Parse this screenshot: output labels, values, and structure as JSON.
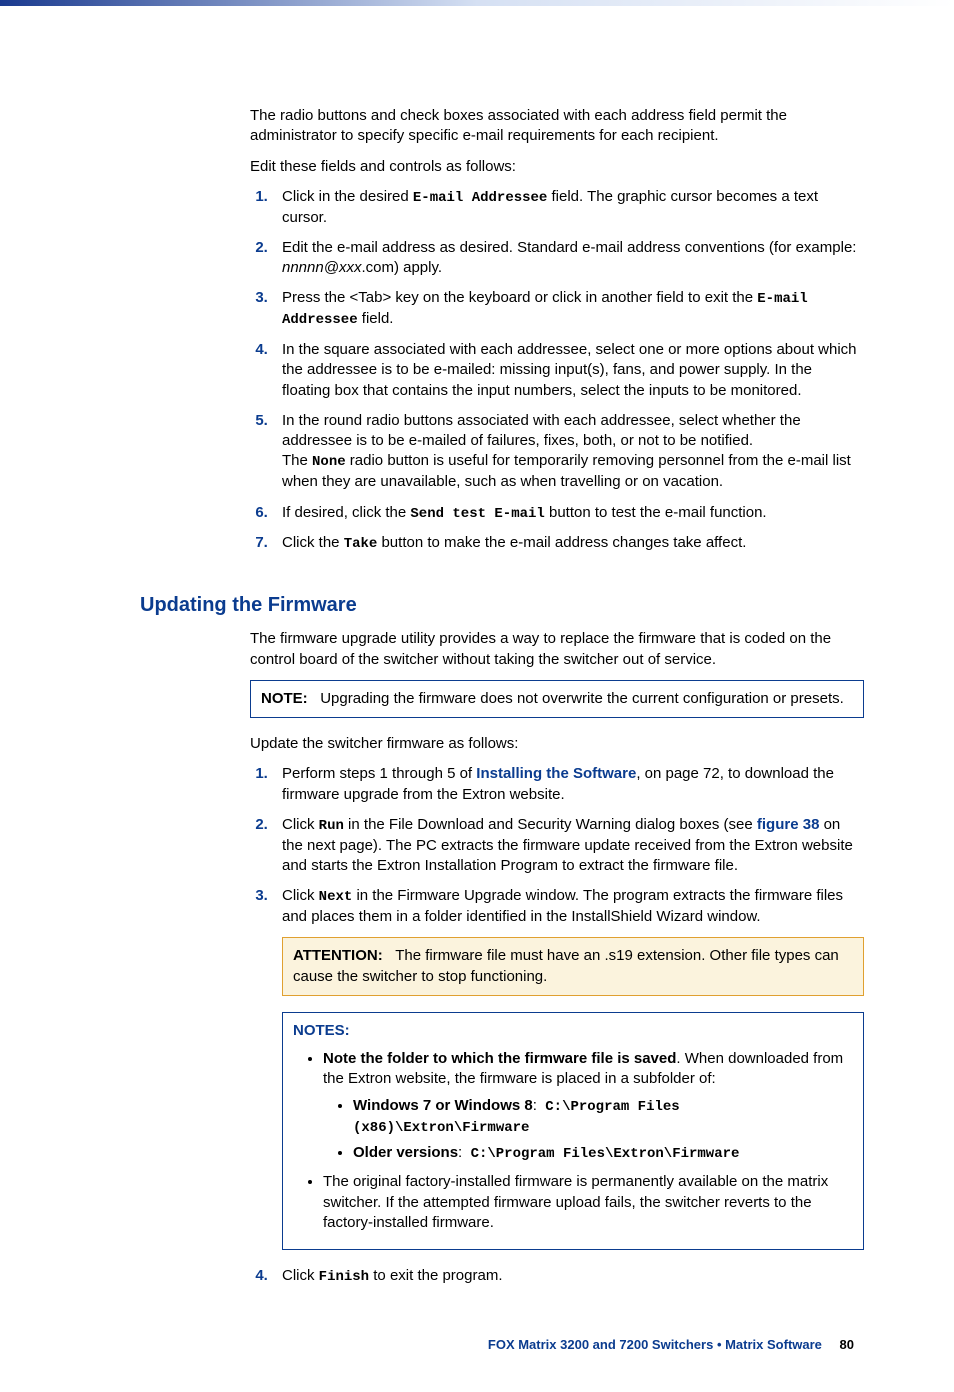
{
  "intro": {
    "p1": "The radio buttons and check boxes associated with each address field permit the administrator to specify specific e-mail requirements for each recipient.",
    "p2": "Edit these fields and controls as follows:",
    "li1a": "Click in the desired ",
    "li1code": "E-mail Addressee",
    "li1b": " field. The graphic cursor becomes a text cursor.",
    "li2a": "Edit the e-mail address as desired. Standard e-mail address conventions (for example: ",
    "li2i": "nnnnn@xxx",
    "li2b": ".com) apply.",
    "li3a": "Press the <Tab> key on the keyboard or click in another field to exit the ",
    "li3code": "E-mail Addressee",
    "li3b": " field.",
    "li4": "In the square associated with each addressee, select one or more options about which the addressee is to be e-mailed: missing input(s), fans, and power supply. In the floating box that contains the input numbers, select the inputs to be monitored.",
    "li5a": "In the round radio buttons associated with each addressee, select whether the addressee is to be e-mailed of failures, fixes, both, or not to be notified.",
    "li5b_pre": "The ",
    "li5b_code": "None",
    "li5b_post": " radio button is useful for temporarily removing personnel from the e-mail list when they are unavailable, such as when travelling or on vacation.",
    "li6a": "If desired, click the ",
    "li6code": "Send test E-mail",
    "li6b": " button to test the e-mail function.",
    "li7a": "Click the ",
    "li7code": "Take",
    "li7b": " button to make the e-mail address changes take affect."
  },
  "section": {
    "heading": "Updating the Firmware",
    "p1": "The firmware upgrade utility provides a way to replace the firmware that is coded on the control board of the switcher without taking the switcher out of service.",
    "note_label": "NOTE:",
    "note_body": "Upgrading the firmware does not overwrite the current configuration or presets.",
    "p2": "Update the switcher firmware as follows:",
    "li1a": "Perform steps 1 through 5 of ",
    "li1link": "Installing the Software",
    "li1b": ", on page 72, to download the firmware upgrade from the Extron website.",
    "li2a": "Click ",
    "li2code": "Run",
    "li2b": " in the File Download and Security Warning dialog boxes (see ",
    "li2link": "figure 38",
    "li2c": " on the next page). The PC extracts the firmware update received from the Extron website and starts the Extron Installation Program to extract the firmware file.",
    "li3a": "Click ",
    "li3code": "Next",
    "li3b": " in the Firmware Upgrade window. The program extracts the firmware files and places them in a folder identified in the InstallShield Wizard window.",
    "attention_label": "ATTENTION:",
    "attention_body": "The firmware file must have an .s19 extension. Other file types can cause the switcher to stop functioning.",
    "notes_label": "NOTES:",
    "notes_b1a": "Note the folder to which the firmware file is saved",
    "notes_b1b": ". When downloaded from the Extron website, the firmware is placed in a subfolder of:",
    "notes_sub1_label": "Windows 7 or Windows 8",
    "notes_sub1_path": "C:\\Program Files (x86)\\Extron\\Firmware",
    "notes_sub2_label": "Older versions",
    "notes_sub2_path": "C:\\Program Files\\Extron\\Firmware",
    "notes_b2": "The original factory-installed firmware is permanently available on the matrix switcher. If the attempted firmware upload fails, the switcher reverts to the factory-installed firmware.",
    "li4a": "Click ",
    "li4code": "Finish",
    "li4b": " to exit the program."
  },
  "footer": {
    "title": "FOX Matrix 3200 and 7200 Switchers • Matrix Software",
    "page": "80"
  }
}
